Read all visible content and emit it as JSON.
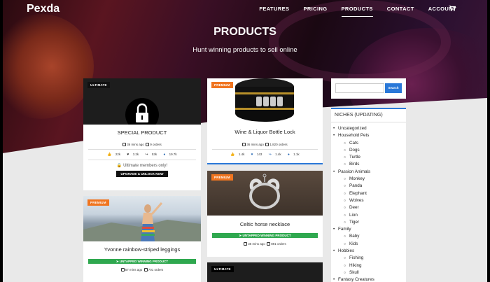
{
  "brand": "Pexda",
  "nav": [
    "FEATURES",
    "PRICING",
    "PRODUCTS",
    "CONTACT",
    "ACCOUNT"
  ],
  "nav_active": "PRODUCTS",
  "icons": {
    "cart": "cart-icon",
    "lock": "lock-icon",
    "clock": "clock-icon",
    "basket": "basket-icon"
  },
  "hero": {
    "title": "PRODUCTS",
    "subtitle": "Hunt winning products to sell online"
  },
  "cards": {
    "special": {
      "badge": "ULTIMATE",
      "title": "SPECIAL PRODUCT",
      "time": "36 mins ago",
      "orders": "9 orders",
      "likes": "22k",
      "hearts": "3.2k",
      "shares": "53k",
      "comments": "19.7k",
      "members_note": "Ultimate members only!",
      "upgrade": "UPGRADE & UNLOCK NOW"
    },
    "leggings": {
      "badge": "PREMIUM",
      "title": "Yvonne rainbow-striped leggings",
      "tag": "UNTAPPED WINNING PRODUCT",
      "time": "57 mins ago",
      "orders": "701 orders"
    },
    "lock": {
      "badge": "PREMIUM",
      "title": "Wine & Liquor Bottle Lock",
      "time": "36 mins ago",
      "orders": "1,820 orders",
      "likes": "1.4k",
      "hearts": "143",
      "shares": "1.4k",
      "comments": "1.1k"
    },
    "necklace": {
      "badge": "PREMIUM",
      "title": "Celtic horse necklace",
      "tag": "UNTAPPED WINNING PRODUCT",
      "time": "36 mins ago",
      "orders": "891 orders"
    },
    "last": {
      "badge": "ULTIMATE"
    }
  },
  "sidebar": {
    "search_placeholder": "",
    "search_button": "Search",
    "niches_title": "NICHES (UPDATING)",
    "niches": [
      {
        "label": "Uncategorized",
        "sub": []
      },
      {
        "label": "Household Pets",
        "sub": [
          "Cats",
          "Dogs",
          "Turtle",
          "Birds"
        ]
      },
      {
        "label": "Passion Animals",
        "sub": [
          "Monkey",
          "Panda",
          "Elephant",
          "Wolves",
          "Deer",
          "Lion",
          "Tiger"
        ]
      },
      {
        "label": "Family",
        "sub": [
          "Baby",
          "Kids"
        ]
      },
      {
        "label": "Hobbies",
        "sub": [
          "Fishing",
          "Hiking",
          "Skull"
        ]
      },
      {
        "label": "Fantasy Creatures",
        "sub": []
      }
    ]
  },
  "colors": {
    "accent": "#2a78d8",
    "premium": "#f07520",
    "ultimate": "#111111",
    "untapped": "#2fa84f"
  }
}
